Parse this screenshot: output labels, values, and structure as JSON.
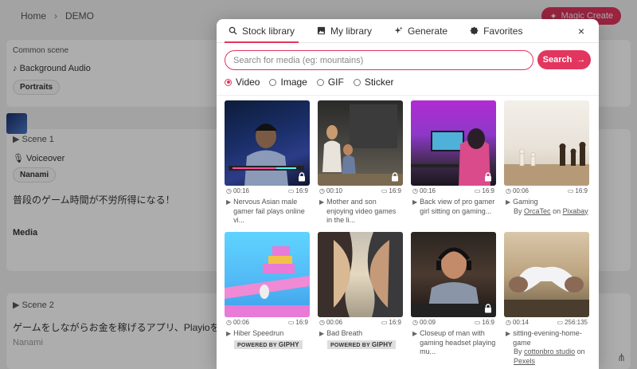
{
  "background": {
    "breadcrumb": {
      "home": "Home",
      "separator": "›",
      "project": "DEMO"
    },
    "magic_create_label": "Magic Create",
    "common_scene": {
      "title": "Common scene",
      "audio_label": "Background Audio",
      "audio_chip": "Portraits"
    },
    "scene1": {
      "title": "Scene 1",
      "voiceover_label": "Voiceover",
      "voice_chip": "Nanami",
      "script": "普段のゲーム時間が不労所得になる！",
      "media_label": "Media"
    },
    "scene2": {
      "title": "Scene 2",
      "script": "ゲームをしながらお金を稼げるアプリ、Playioをご紹介",
      "voiceover_label": "Nanami"
    }
  },
  "modal": {
    "tabs": [
      {
        "label": "Stock library",
        "icon": "search-icon",
        "active": true
      },
      {
        "label": "My library",
        "icon": "image-icon",
        "active": false
      },
      {
        "label": "Generate",
        "icon": "sparkle-icon",
        "active": false
      },
      {
        "label": "Favorites",
        "icon": "badge-icon",
        "active": false
      }
    ],
    "close_label": "×",
    "search": {
      "placeholder": "Search for media (eg: mountains)",
      "value": "",
      "button_label": "Search"
    },
    "media_types": [
      {
        "label": "Video",
        "checked": true
      },
      {
        "label": "Image",
        "checked": false
      },
      {
        "label": "GIF",
        "checked": false
      },
      {
        "label": "Sticker",
        "checked": false
      }
    ],
    "items": [
      {
        "duration": "00:16",
        "ratio": "16:9",
        "title": "Nervous Asian male gamer fail plays online vi...",
        "locked": true
      },
      {
        "duration": "00:10",
        "ratio": "16:9",
        "title": "Mother and son enjoying video games in the li...",
        "locked": true
      },
      {
        "duration": "00:16",
        "ratio": "16:9",
        "title": "Back view of pro gamer girl sitting on gaming...",
        "locked": true
      },
      {
        "duration": "00:06",
        "ratio": "16:9",
        "title": "Gaming",
        "by": "By",
        "author": "OrcaTec",
        "on": "on",
        "source": "Pixabay",
        "locked": false
      },
      {
        "duration": "00:06",
        "ratio": "16:9",
        "title": "Hiber Speedrun",
        "badge": "POWERED BY",
        "badge_brand": "GIPHY",
        "locked": false
      },
      {
        "duration": "00:06",
        "ratio": "16:9",
        "title": "Bad Breath",
        "badge": "POWERED BY",
        "badge_brand": "GIPHY",
        "locked": false
      },
      {
        "duration": "00:09",
        "ratio": "16:9",
        "title": "Closeup of man with gaming headset playing mu...",
        "locked": true
      },
      {
        "duration": "00:14",
        "ratio": "256:135",
        "title": "sitting-evening-home-game",
        "by": "By",
        "author": "cottonbro studio",
        "on": "on",
        "source": "Pexels",
        "locked": false
      }
    ]
  },
  "colors": {
    "accent": "#e2365f"
  }
}
